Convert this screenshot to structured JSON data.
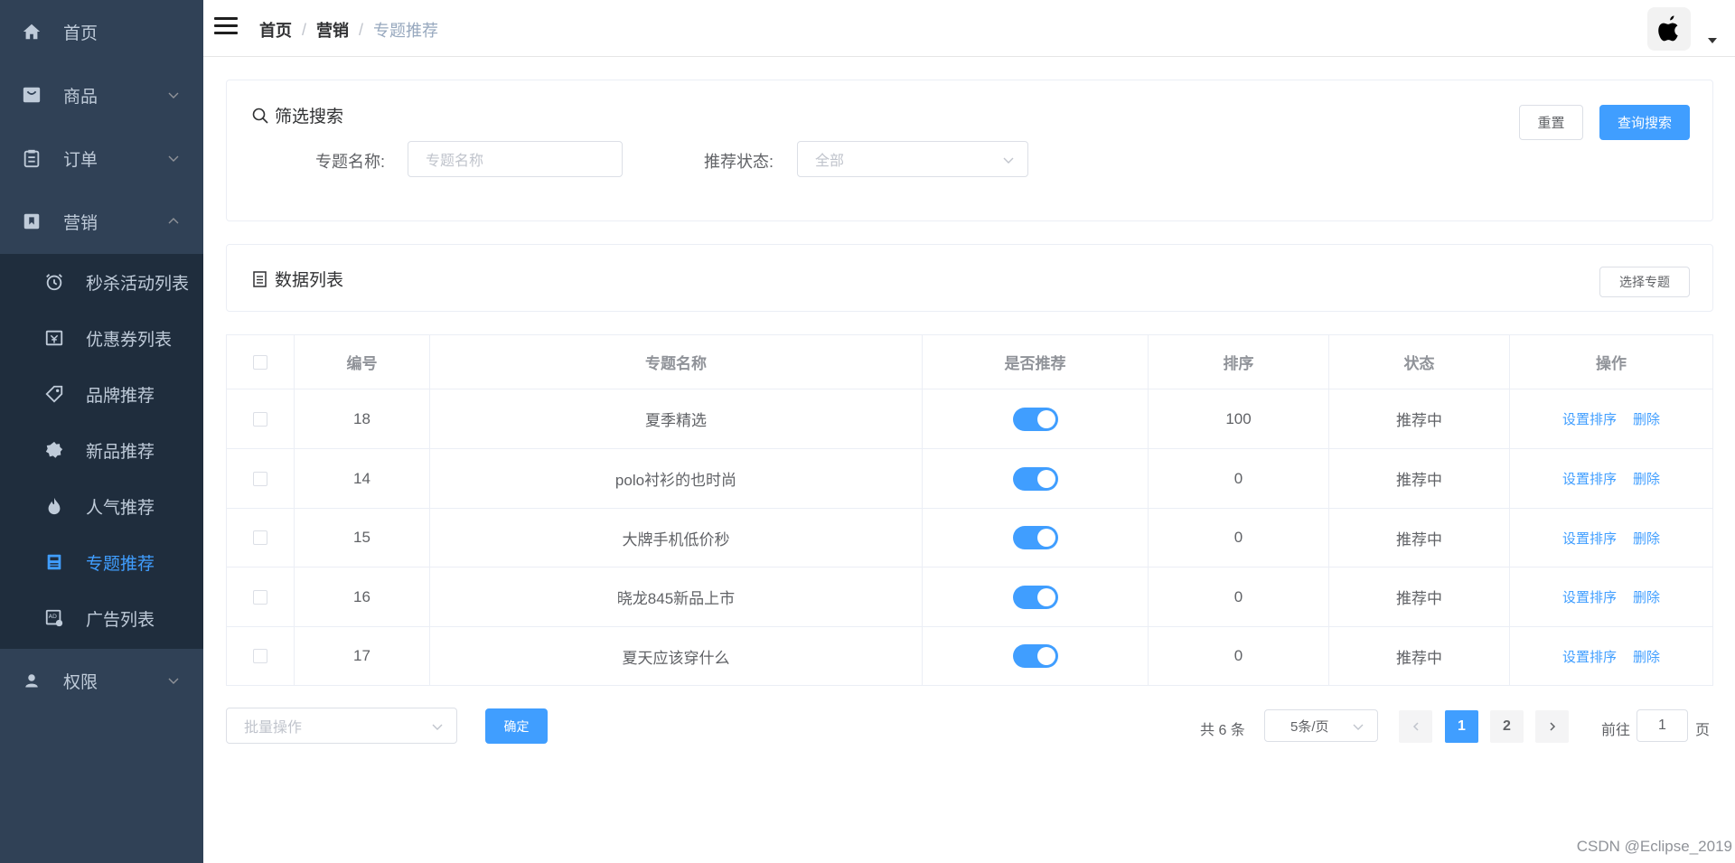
{
  "sidebar": {
    "items": [
      {
        "label": "首页",
        "icon": "home-icon"
      },
      {
        "label": "商品",
        "icon": "shopping-bag-icon"
      },
      {
        "label": "订单",
        "icon": "clipboard-icon"
      },
      {
        "label": "营销",
        "icon": "bookmark-icon"
      },
      {
        "label": "权限",
        "icon": "user-icon"
      }
    ],
    "marketing_submenu": [
      {
        "label": "秒杀活动列表",
        "icon": "alarm-clock-icon"
      },
      {
        "label": "优惠券列表",
        "icon": "coupon-icon"
      },
      {
        "label": "品牌推荐",
        "icon": "tag-icon"
      },
      {
        "label": "新品推荐",
        "icon": "new-badge-icon"
      },
      {
        "label": "人气推荐",
        "icon": "hot-flame-icon"
      },
      {
        "label": "专题推荐",
        "icon": "topic-icon",
        "active": true
      },
      {
        "label": "广告列表",
        "icon": "ad-icon"
      }
    ]
  },
  "header": {
    "breadcrumb": [
      "首页",
      "营销",
      "专题推荐"
    ],
    "breadcrumb_separator": "/"
  },
  "filter": {
    "title": "筛选搜索",
    "topic_name_label": "专题名称:",
    "topic_name_placeholder": "专题名称",
    "recommend_status_label": "推荐状态:",
    "recommend_status_value": "全部",
    "reset_label": "重置",
    "search_label": "查询搜索"
  },
  "list": {
    "title": "数据列表",
    "select_topic_label": "选择专题"
  },
  "table": {
    "columns": [
      "编号",
      "专题名称",
      "是否推荐",
      "排序",
      "状态",
      "操作"
    ],
    "rows": [
      {
        "id": "18",
        "name": "夏季精选",
        "recommend": true,
        "sort": "100",
        "status": "推荐中"
      },
      {
        "id": "14",
        "name": "polo衬衫的也时尚",
        "recommend": true,
        "sort": "0",
        "status": "推荐中"
      },
      {
        "id": "15",
        "name": "大牌手机低价秒",
        "recommend": true,
        "sort": "0",
        "status": "推荐中"
      },
      {
        "id": "16",
        "name": "晓龙845新品上市",
        "recommend": true,
        "sort": "0",
        "status": "推荐中"
      },
      {
        "id": "17",
        "name": "夏天应该穿什么",
        "recommend": true,
        "sort": "0",
        "status": "推荐中"
      }
    ],
    "action_set_sort": "设置排序",
    "action_delete": "删除"
  },
  "batch": {
    "placeholder": "批量操作",
    "confirm_label": "确定"
  },
  "pagination": {
    "total_text": "共 6 条",
    "page_size": "5条/页",
    "pages": [
      "1",
      "2"
    ],
    "current_page": "1",
    "goto_prefix": "前往",
    "goto_value": "1",
    "goto_suffix": "页"
  },
  "watermark": "CSDN @Eclipse_2019",
  "colors": {
    "sidebar_bg": "#304156",
    "submenu_bg": "#1f2d3d",
    "accent": "#409eff"
  }
}
